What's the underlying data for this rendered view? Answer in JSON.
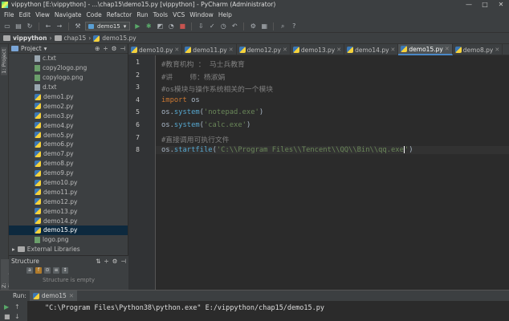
{
  "window": {
    "title": "vippython [E:\\vippython] - ...\\chap15\\demo15.py [vippython] - PyCharm (Administrator)",
    "controls": [
      "—",
      "□",
      "✕"
    ]
  },
  "menu": [
    "File",
    "Edit",
    "View",
    "Navigate",
    "Code",
    "Refactor",
    "Run",
    "Tools",
    "VCS",
    "Window",
    "Help"
  ],
  "toolbar": {
    "run_config": "demo15"
  },
  "breadcrumb": [
    "vippython",
    "chap15",
    "demo15.py"
  ],
  "side_strip": {
    "project_label": "1: Project",
    "structure_label": "Z: Structure"
  },
  "project_panel": {
    "title": "Project",
    "files": [
      {
        "name": "c.txt",
        "type": "txt"
      },
      {
        "name": "copy2logo.png",
        "type": "png"
      },
      {
        "name": "copylogo.png",
        "type": "png"
      },
      {
        "name": "d.txt",
        "type": "txt"
      },
      {
        "name": "demo1.py",
        "type": "py"
      },
      {
        "name": "demo2.py",
        "type": "py"
      },
      {
        "name": "demo3.py",
        "type": "py"
      },
      {
        "name": "demo4.py",
        "type": "py"
      },
      {
        "name": "demo5.py",
        "type": "py"
      },
      {
        "name": "demo6.py",
        "type": "py"
      },
      {
        "name": "demo7.py",
        "type": "py"
      },
      {
        "name": "demo8.py",
        "type": "py"
      },
      {
        "name": "demo9.py",
        "type": "py"
      },
      {
        "name": "demo10.py",
        "type": "py"
      },
      {
        "name": "demo11.py",
        "type": "py"
      },
      {
        "name": "demo12.py",
        "type": "py"
      },
      {
        "name": "demo13.py",
        "type": "py"
      },
      {
        "name": "demo14.py",
        "type": "py"
      },
      {
        "name": "demo15.py",
        "type": "py",
        "selected": true
      },
      {
        "name": "logo.png",
        "type": "png"
      }
    ],
    "external": "External Libraries"
  },
  "structure_panel": {
    "title": "Structure",
    "empty_text": "Structure is empty"
  },
  "tabs": [
    {
      "label": "demo10.py",
      "active": false
    },
    {
      "label": "demo11.py",
      "active": false
    },
    {
      "label": "demo12.py",
      "active": false
    },
    {
      "label": "demo13.py",
      "active": false
    },
    {
      "label": "demo14.py",
      "active": false
    },
    {
      "label": "demo15.py",
      "active": true
    },
    {
      "label": "demo8.py",
      "active": false
    }
  ],
  "code": [
    {
      "n": "1",
      "text": "#教育机构 ： 马士兵教育"
    },
    {
      "n": "2",
      "text": "#讲    师：杨淑娟"
    },
    {
      "n": "3",
      "text": "#os模块与操作系统相关的一个模块"
    },
    {
      "n": "4",
      "text": "import os"
    },
    {
      "n": "5",
      "text": "os.system('notepad.exe')"
    },
    {
      "n": "6",
      "text": "os.system('calc.exe')"
    },
    {
      "n": "7",
      "text": "#直接调用可执行文件"
    },
    {
      "n": "8",
      "text": "os.startfile('C:\\\\Program Files\\\\Tencent\\\\QQ\\\\Bin\\\\qq.exe')"
    }
  ],
  "run_panel": {
    "label": "Run:",
    "tab": "demo15",
    "console": "\"C:\\Program Files\\Python38\\python.exe\" E:/vippython/chap15/demo15.py"
  }
}
